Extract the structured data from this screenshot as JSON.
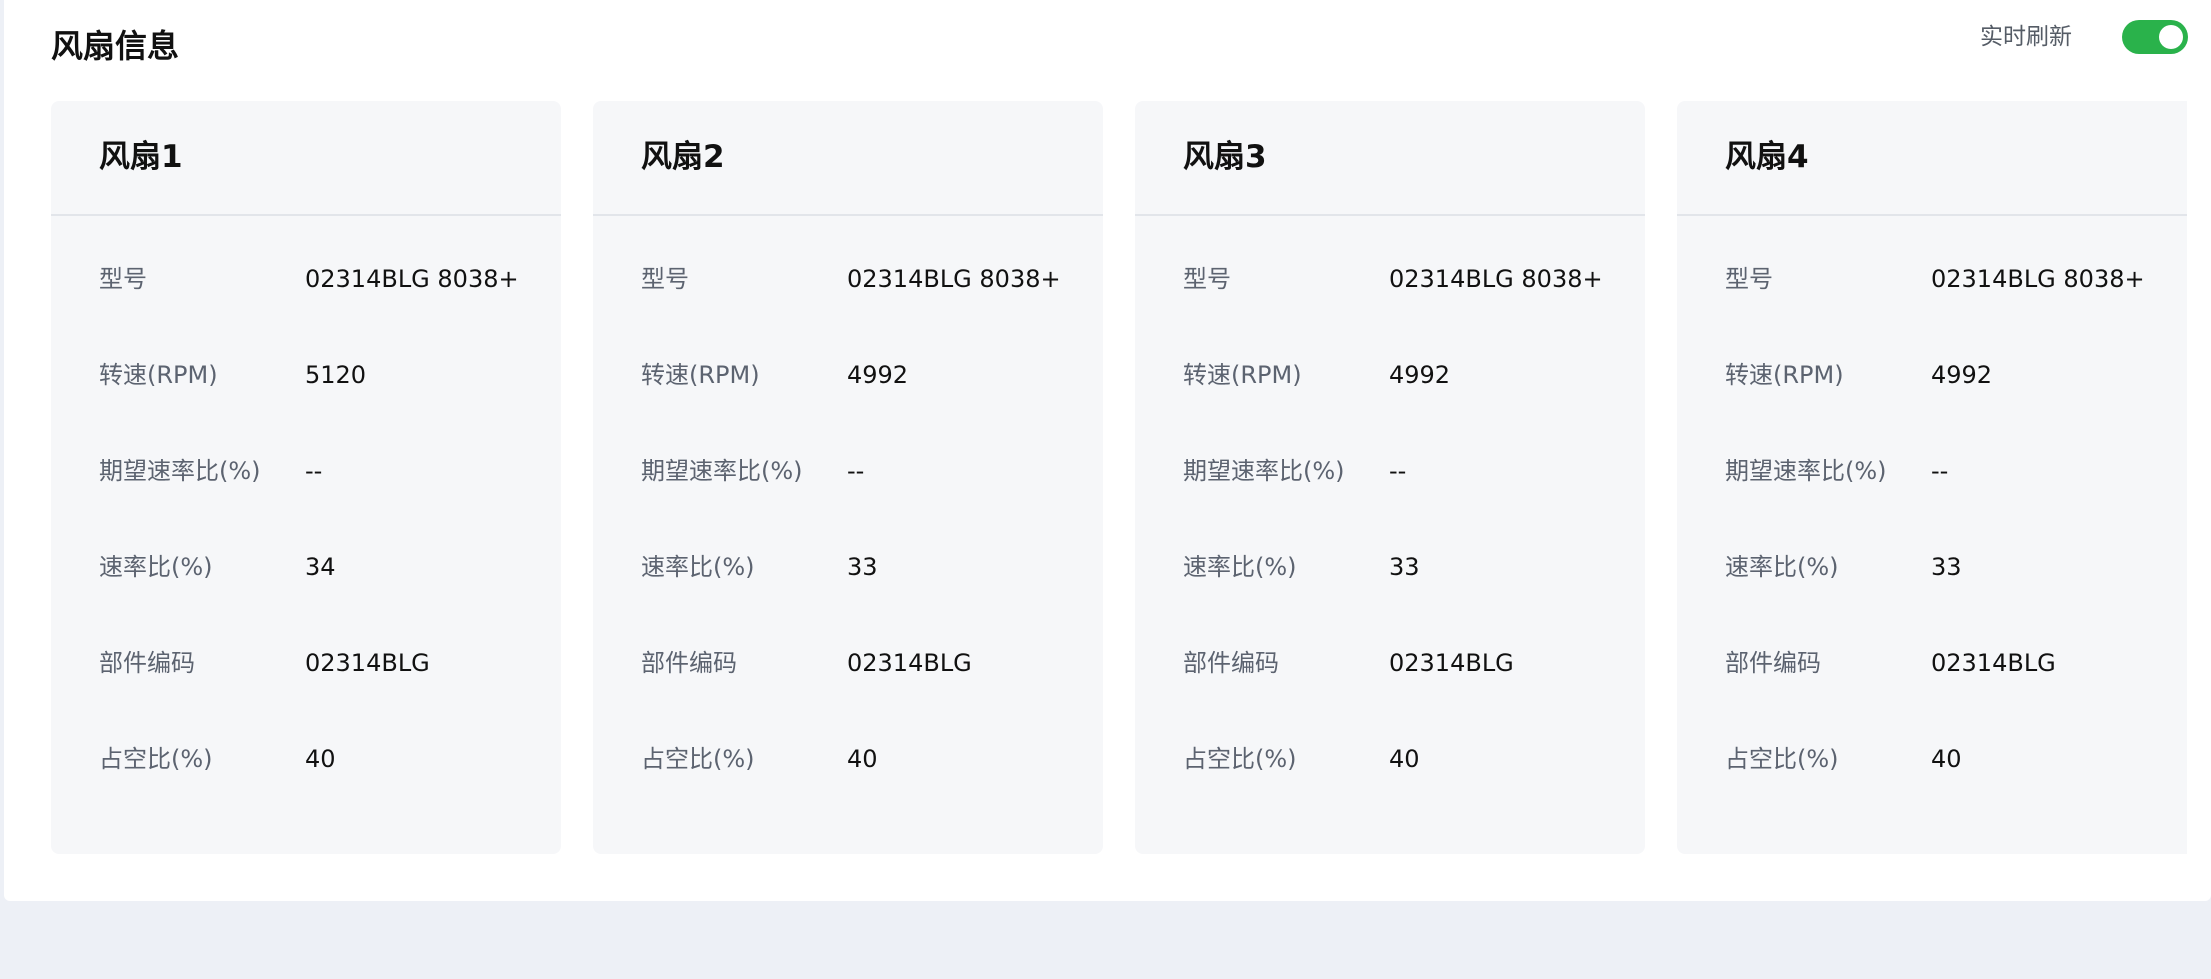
{
  "header": {
    "title": "风扇信息",
    "realtime_refresh_label": "实时刷新",
    "realtime_refresh_enabled": true,
    "toggle_color": "#2ab24b"
  },
  "fans": [
    {
      "title": "风扇1",
      "fields": [
        {
          "label": "型号",
          "value": "02314BLG 8038+"
        },
        {
          "label": "转速(RPM)",
          "value": "5120"
        },
        {
          "label": "期望速率比(%)",
          "value": "--"
        },
        {
          "label": "速率比(%)",
          "value": "34"
        },
        {
          "label": "部件编码",
          "value": "02314BLG"
        },
        {
          "label": "占空比(%)",
          "value": "40"
        }
      ]
    },
    {
      "title": "风扇2",
      "fields": [
        {
          "label": "型号",
          "value": "02314BLG 8038+"
        },
        {
          "label": "转速(RPM)",
          "value": "4992"
        },
        {
          "label": "期望速率比(%)",
          "value": "--"
        },
        {
          "label": "速率比(%)",
          "value": "33"
        },
        {
          "label": "部件编码",
          "value": "02314BLG"
        },
        {
          "label": "占空比(%)",
          "value": "40"
        }
      ]
    },
    {
      "title": "风扇3",
      "fields": [
        {
          "label": "型号",
          "value": "02314BLG 8038+"
        },
        {
          "label": "转速(RPM)",
          "value": "4992"
        },
        {
          "label": "期望速率比(%)",
          "value": "--"
        },
        {
          "label": "速率比(%)",
          "value": "33"
        },
        {
          "label": "部件编码",
          "value": "02314BLG"
        },
        {
          "label": "占空比(%)",
          "value": "40"
        }
      ]
    },
    {
      "title": "风扇4",
      "fields": [
        {
          "label": "型号",
          "value": "02314BLG 8038+"
        },
        {
          "label": "转速(RPM)",
          "value": "4992"
        },
        {
          "label": "期望速率比(%)",
          "value": "--"
        },
        {
          "label": "速率比(%)",
          "value": "33"
        },
        {
          "label": "部件编码",
          "value": "02314BLG"
        },
        {
          "label": "占空比(%)",
          "value": "40"
        }
      ]
    }
  ]
}
